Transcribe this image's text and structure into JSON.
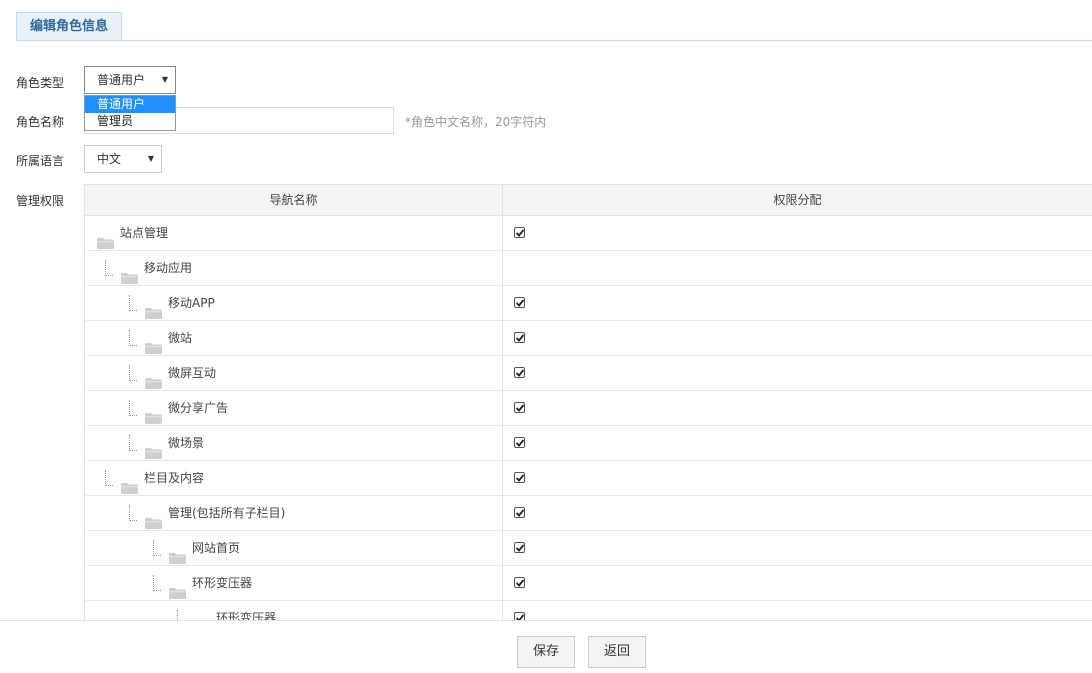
{
  "header": {
    "tab_title": "编辑角色信息"
  },
  "form": {
    "role_type": {
      "label": "角色类型",
      "value": "普通用户",
      "options": [
        "普通用户",
        "管理员"
      ]
    },
    "role_name": {
      "label": "角色名称",
      "value": "",
      "hint": "*角色中文名称，20字符内"
    },
    "language": {
      "label": "所属语言",
      "value": "中文"
    },
    "permissions": {
      "label": "管理权限"
    }
  },
  "table": {
    "headers": [
      "导航名称",
      "权限分配"
    ],
    "rows": [
      {
        "name": "站点管理",
        "checked": true
      },
      {
        "name": "移动应用",
        "checked": null
      },
      {
        "name": "移动APP",
        "checked": true
      },
      {
        "name": "微站",
        "checked": true
      },
      {
        "name": "微屏互动",
        "checked": true
      },
      {
        "name": "微分享广告",
        "checked": true
      },
      {
        "name": "微场景",
        "checked": true
      },
      {
        "name": "栏目及内容",
        "checked": true
      },
      {
        "name": "管理(包括所有子栏目)",
        "checked": true
      },
      {
        "name": "网站首页",
        "checked": true
      },
      {
        "name": "环形变压器",
        "checked": true
      },
      {
        "name": "环形变压器",
        "checked": true
      }
    ]
  },
  "footer": {
    "save_label": "保存",
    "back_label": "返回"
  },
  "icons": {
    "folder": "folder-icon",
    "dropdown": "caret-down-icon",
    "check": "check-icon"
  },
  "colors": {
    "accent": "#2f6a9a",
    "selection": "#1e90ff",
    "folder": "#cfcfcf"
  }
}
